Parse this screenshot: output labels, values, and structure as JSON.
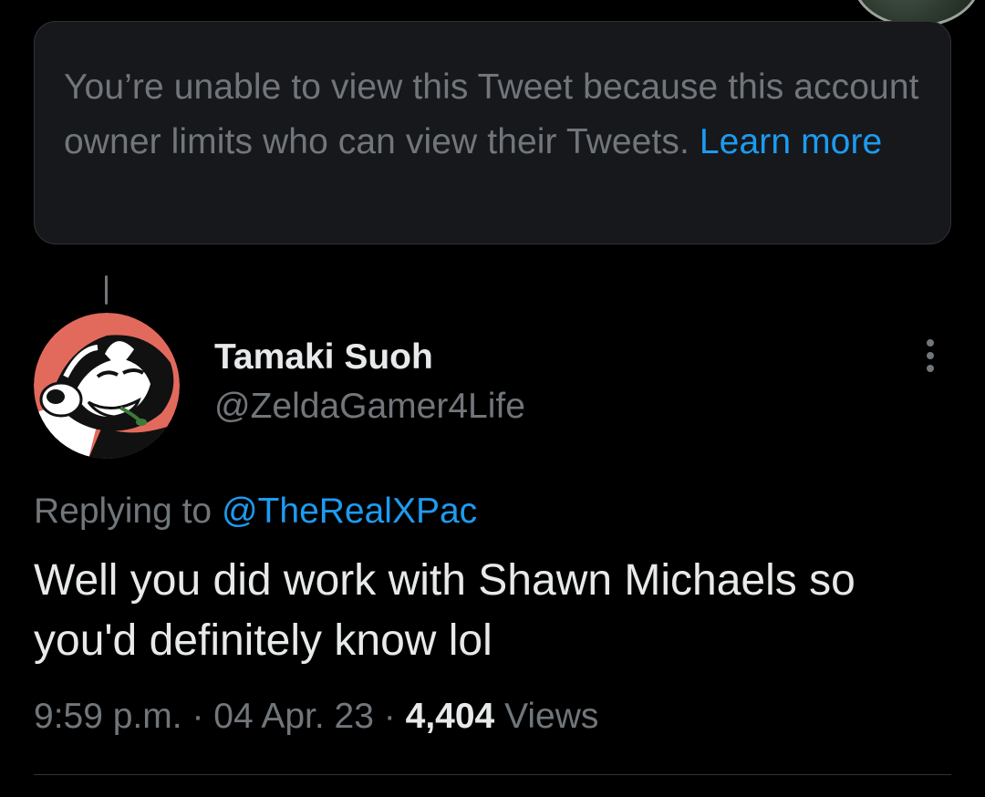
{
  "notice": {
    "text": "You’re unable to view this Tweet because this account owner limits who can view their Tweets.",
    "link_label": "Learn more"
  },
  "tweet": {
    "author": {
      "display_name": "Tamaki Suoh",
      "handle": "@ZeldaGamer4Life",
      "avatar_icon": "cartoon-skunk-avatar"
    },
    "replying_to_prefix": "Replying to",
    "replying_to_handle": "@TheRealXPac",
    "text": "Well you did work with Shawn Michaels so you'd definitely know lol",
    "time": "9:59 p.m.",
    "separator": "·",
    "date": "04 Apr. 23",
    "views_count": "4,404",
    "views_label": "Views",
    "more_icon": "more-vertical-icon"
  },
  "colors": {
    "background": "#000000",
    "notice_background": "#16181c",
    "primary_text": "#e7e9ea",
    "secondary_text": "#71767b",
    "link": "#1d9bf0",
    "border": "#2f3336"
  }
}
